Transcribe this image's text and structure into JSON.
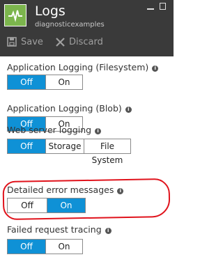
{
  "header": {
    "title": "Logs",
    "subtitle": "diagnosticexamples",
    "app_icon": "activity-pulse-icon"
  },
  "toolbar": {
    "save_label": "Save",
    "discard_label": "Discard"
  },
  "sections": [
    {
      "label": "Application Logging (Filesystem)",
      "options": [
        "Off",
        "On"
      ],
      "selected": "Off"
    },
    {
      "label": "Application Logging (Blob)",
      "options": [
        "Off",
        "On"
      ],
      "selected": "Off"
    },
    {
      "label": "Web server logging",
      "options": [
        "Off",
        "Storage",
        "File System"
      ],
      "selected": "Off"
    },
    {
      "label": "Detailed error messages",
      "options": [
        "Off",
        "On"
      ],
      "selected": "On"
    },
    {
      "label": "Failed request tracing",
      "options": [
        "Off",
        "On"
      ],
      "selected": "Off"
    }
  ],
  "colors": {
    "header_bg": "#3a3a3a",
    "accent": "#0f91d6",
    "highlight": "#e0131c",
    "app_tile": "#7cb54d"
  }
}
